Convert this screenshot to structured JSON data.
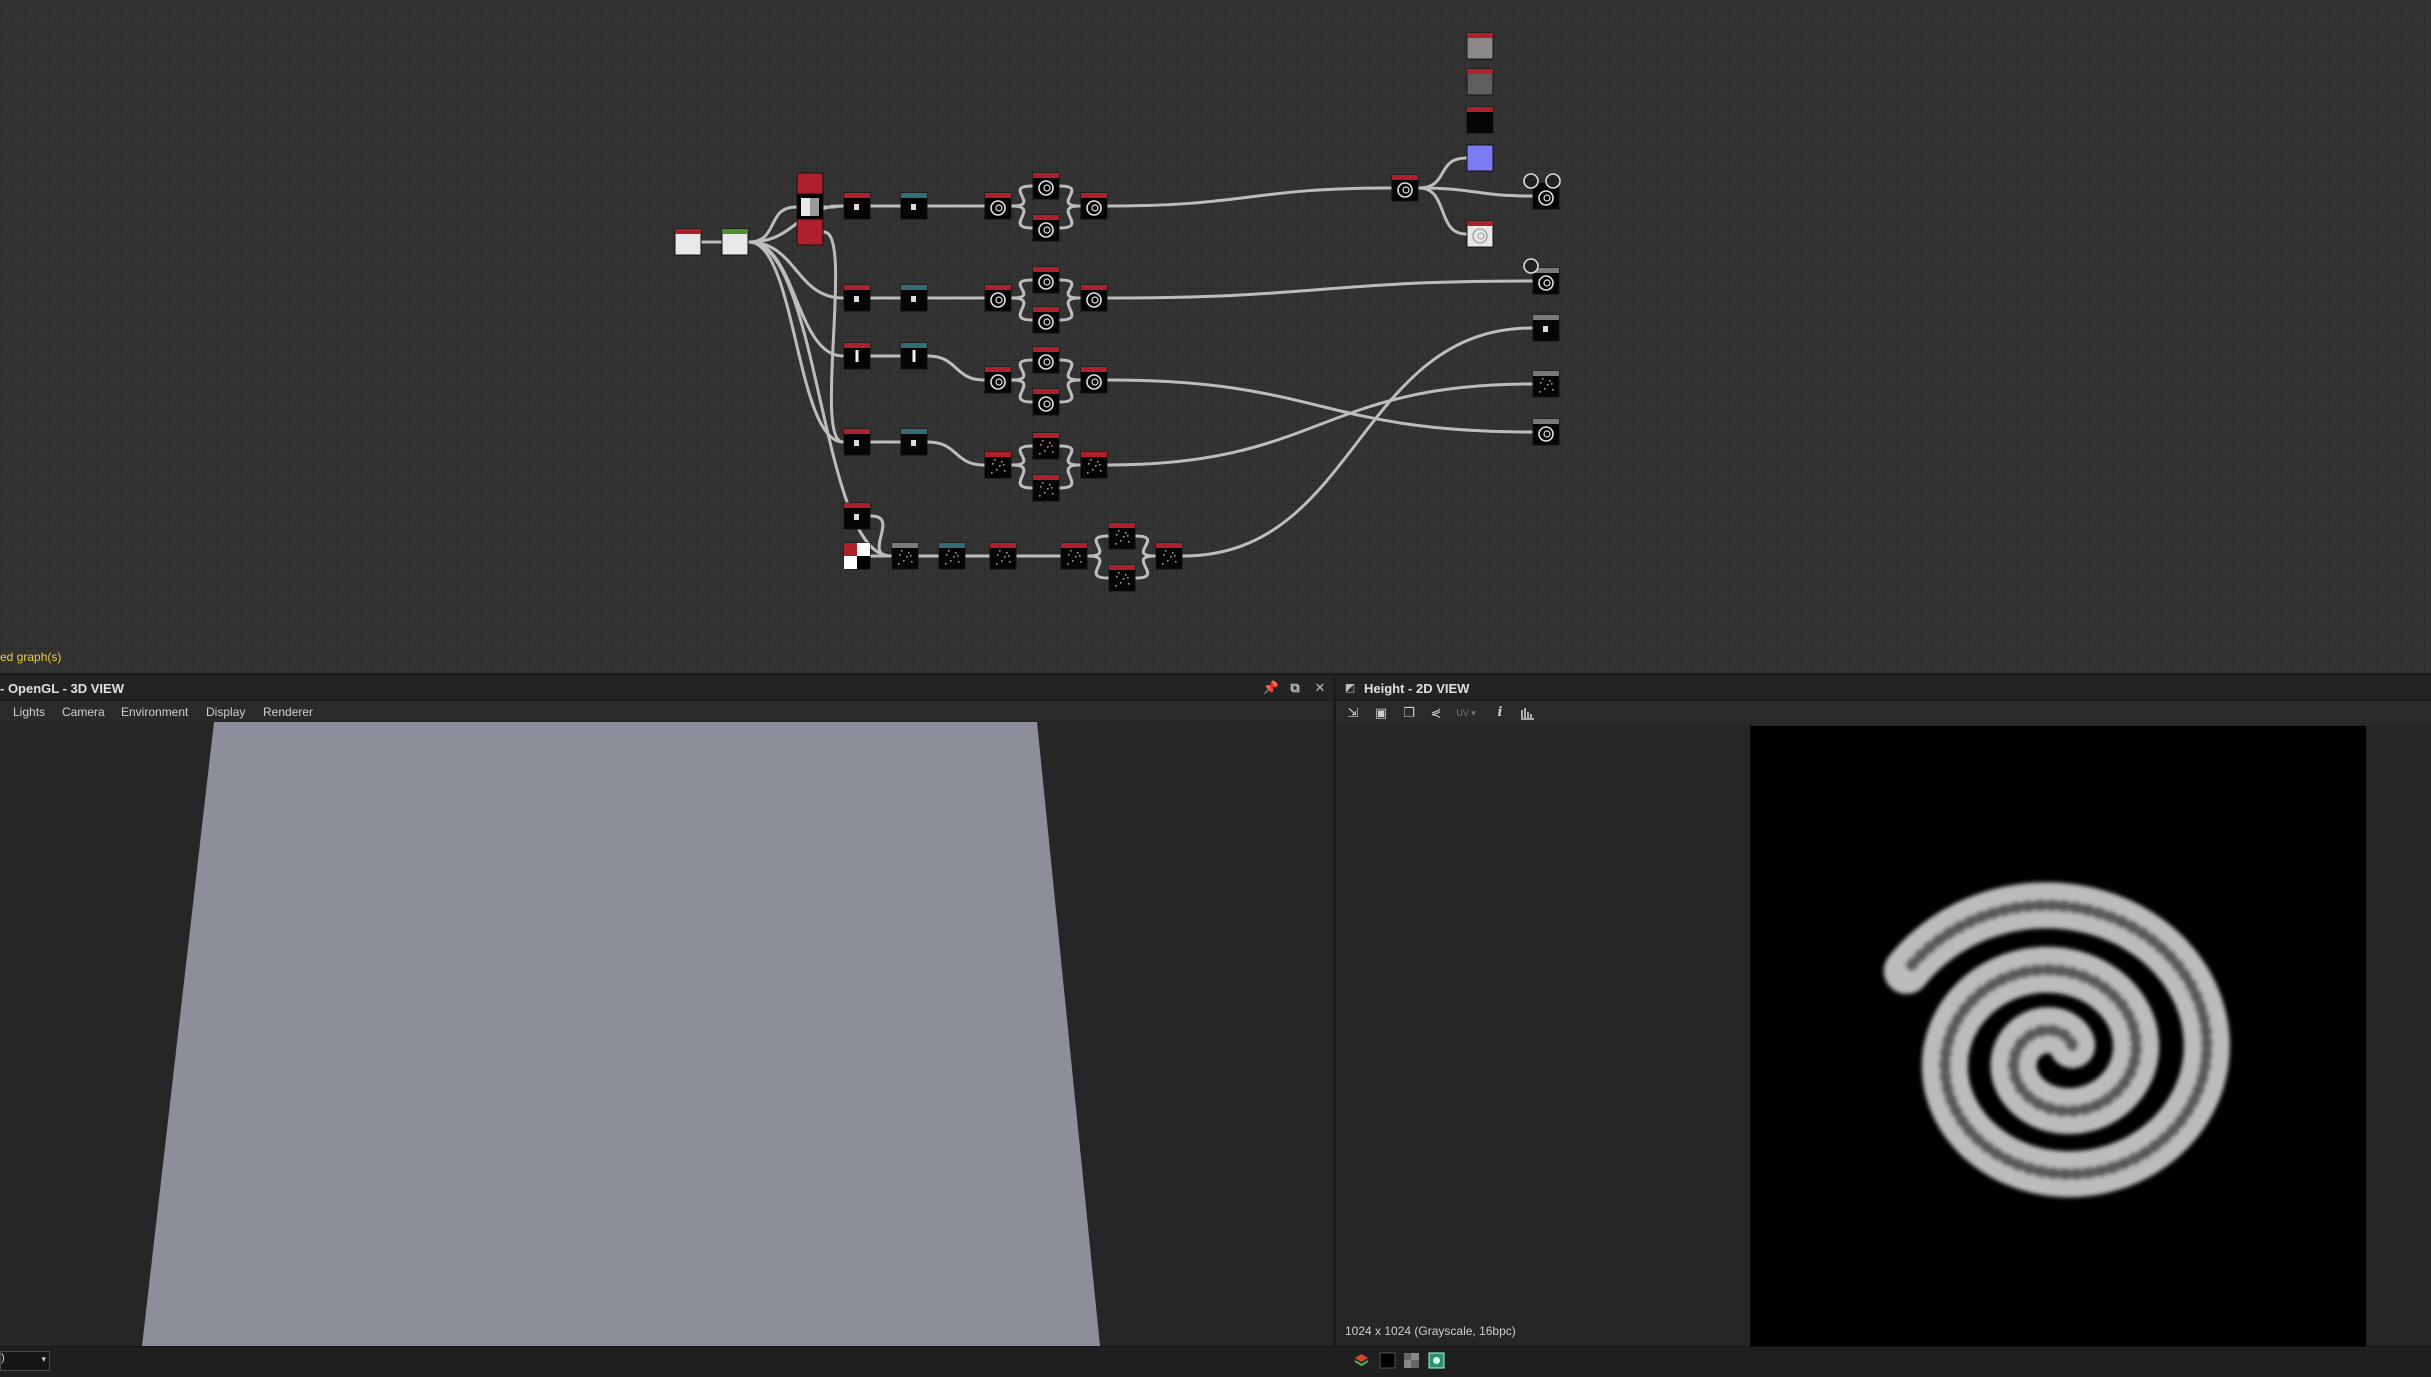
{
  "graph": {
    "status_text": "ed graph(s)",
    "colors": {
      "link": "#bdbdbd",
      "node_header_red": "#b0202c",
      "node_header_teal": "#2f6f73",
      "node_header_green": "#4a8f2a",
      "node_body": "#050505",
      "swatch_blue": "#7b7bf5"
    }
  },
  "view3d": {
    "title": "- OpenGL - 3D VIEW",
    "menu": [
      "Lights",
      "Camera",
      "Environment",
      "Display",
      "Renderer"
    ],
    "buttons": {
      "pin": "📌",
      "float": "⧉",
      "close": "✕"
    },
    "plane_color": "#8c8f99"
  },
  "view2d": {
    "title": "Height - 2D VIEW",
    "toolbar_icons": [
      "export-icon",
      "save-icon",
      "copy-icon",
      "share-icon",
      "uv-dropdown",
      "info-icon",
      "histogram-icon"
    ],
    "uv_label": "UV",
    "info_label": "i",
    "image_info": "1024 x 1024 (Grayscale, 16bpc)"
  },
  "bottom_bar": {
    "zoom_value": ")",
    "icons": [
      "layers-icon",
      "black-bg-icon",
      "checker-bg-icon",
      "image-icon"
    ]
  }
}
